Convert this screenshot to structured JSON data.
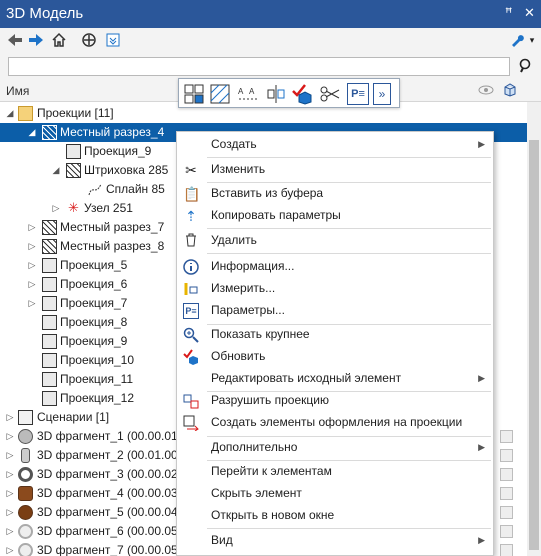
{
  "window": {
    "title": "3D Модель",
    "pin_glyph": "ꟸ",
    "close_glyph": "✕"
  },
  "search": {
    "placeholder": ""
  },
  "header": {
    "name_col": "Имя"
  },
  "floatbar": {
    "params_label": "P≡",
    "more_label": "»"
  },
  "tree": {
    "projections_group": "Проекции [11]",
    "items": [
      "Местный разрез_4",
      "Проекция_9",
      "Штриховка 285",
      "Сплайн 85",
      "Узел 251",
      "Местный разрез_7",
      "Местный разрез_8",
      "Проекция_5",
      "Проекция_6",
      "Проекция_7",
      "Проекция_8",
      "Проекция_9",
      "Проекция_10",
      "Проекция_11",
      "Проекция_12",
      "Сценарии [1]",
      "3D фрагмент_1 (00.00.01 К",
      "3D фрагмент_2 (00.01.00 С",
      "3D фрагмент_3 (00.00.02 К",
      "3D фрагмент_4 (00.00.03 В",
      "3D фрагмент_5 (00.00.04 Ш",
      "3D фрагмент_6 (00.00.05 К",
      "3D фрагмент_7 (00.00.05 К"
    ]
  },
  "menu": {
    "items": [
      "Создать",
      "Изменить",
      "Вставить из буфера",
      "Копировать параметры",
      "Удалить",
      "Информация...",
      "Измерить...",
      "Параметры...",
      "Показать крупнее",
      "Обновить",
      "Редактировать исходный элемент",
      "Разрушить проекцию",
      "Создать элементы оформления на проекции",
      "Дополнительно",
      "Перейти к элементам",
      "Скрыть элемент",
      "Открыть в новом окне",
      "Вид"
    ]
  },
  "colors": {
    "titlebar": "#2b579a",
    "selection": "#0c5ea8",
    "accent_blue": "#1e73c8",
    "check_red": "#d91a1a"
  }
}
